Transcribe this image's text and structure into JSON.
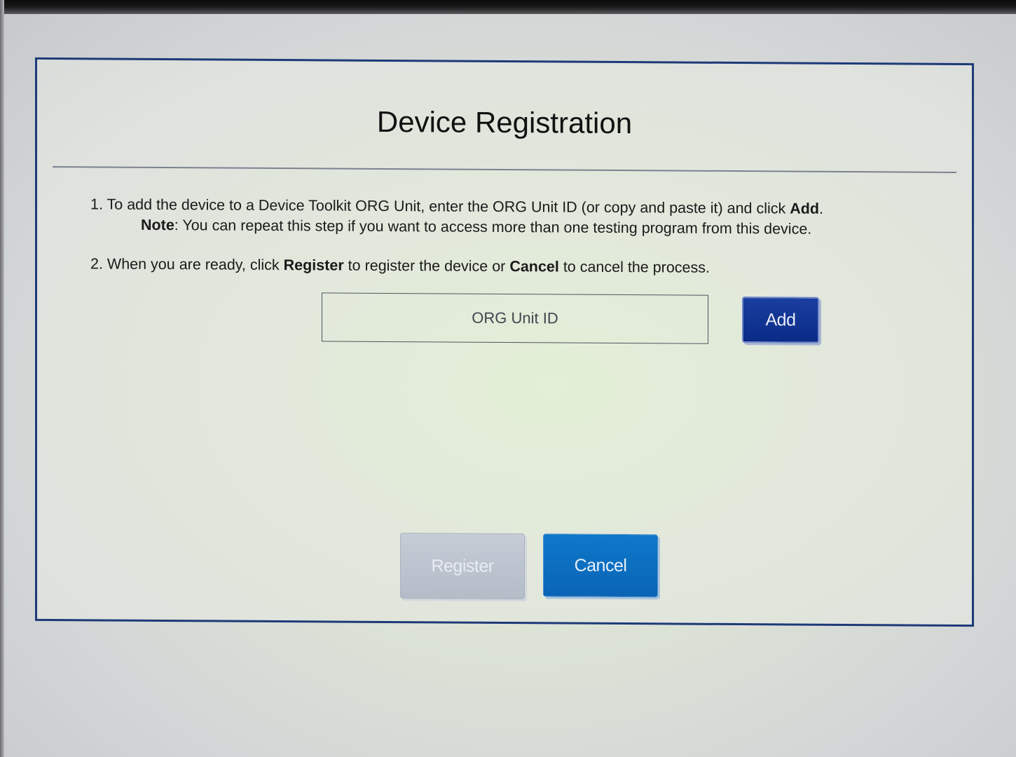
{
  "dialog": {
    "title": "Device Registration",
    "step1": {
      "number": "1.",
      "text_a": "To add the device to a Device Toolkit ORG Unit, enter the ORG Unit ID (or copy and paste it) and click ",
      "bold_add": "Add",
      "end_period": ".",
      "note_label": "Note",
      "note_text": ": You can repeat this step if you want to access more than one testing program from this device."
    },
    "step2": {
      "number": "2.",
      "text_a": "When you are ready, click ",
      "bold_register": "Register",
      "text_b": " to register the device or ",
      "bold_cancel": "Cancel",
      "text_c": " to cancel the process."
    },
    "org_input": {
      "placeholder": "ORG Unit ID",
      "value": ""
    },
    "buttons": {
      "add": "Add",
      "register": "Register",
      "register_state": "disabled",
      "cancel": "Cancel"
    }
  },
  "colors": {
    "dialog_border": "#1d3a78",
    "add_button": "#0a2a86",
    "cancel_button": "#0a64b6",
    "register_disabled": "#b4bcc8"
  }
}
